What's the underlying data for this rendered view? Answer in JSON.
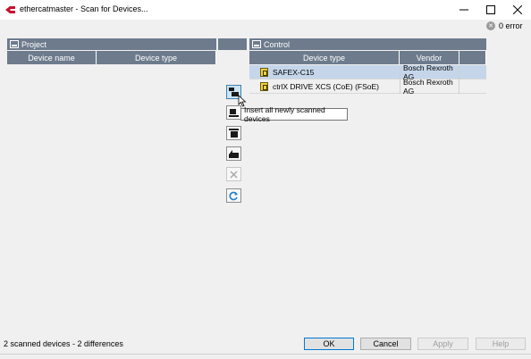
{
  "window": {
    "title": "ethercatmaster - Scan for Devices...",
    "minimize_glyph": "─",
    "maximize_glyph": "☐",
    "close_glyph": "✕"
  },
  "error_indicator": {
    "icon": "error-circle-icon",
    "text": "0 error"
  },
  "project_panel": {
    "title": "Project",
    "columns": [
      "Device name",
      "Device type"
    ]
  },
  "control_panel": {
    "title": "Control",
    "columns": [
      "Device type",
      "Vendor"
    ],
    "rows": [
      {
        "device_type": "SAFEX-C15",
        "vendor": "Bosch Rexroth AG",
        "selected": true
      },
      {
        "device_type": "ctrlX DRIVE XCS (CoE) (FSoE)",
        "vendor": "Bosch Rexroth AG",
        "selected": false
      }
    ]
  },
  "toolbar": {
    "buttons": [
      {
        "icon": "insert-new-devices-icon",
        "active": true
      },
      {
        "icon": "insert-device-icon"
      },
      {
        "icon": "insert-devices-icon"
      },
      {
        "icon": "copy-device-icon"
      },
      {
        "icon": "delete-icon",
        "disabled": true
      },
      {
        "icon": "refresh-icon"
      }
    ],
    "tooltip": "Insert all newly scanned devices"
  },
  "status_text": "2 scanned devices - 2 differences",
  "buttons": {
    "ok": "OK",
    "cancel": "Cancel",
    "apply": "Apply",
    "help": "Help"
  },
  "colors": {
    "header_bg": "#6d7b8d",
    "selected_row": "#c5d6ea",
    "active_tool": "#cce4f7"
  }
}
